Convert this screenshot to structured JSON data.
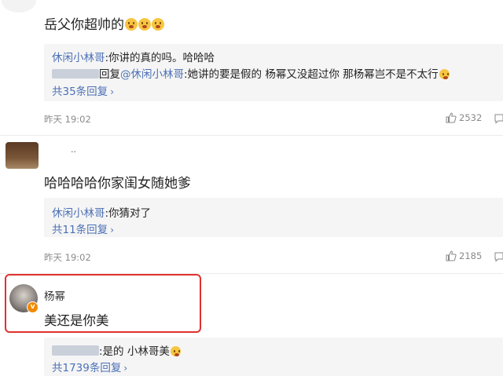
{
  "comment1": {
    "text": "岳父你超帅的",
    "replies": [
      {
        "user": "休闲小林哥",
        "text": ":你讲的真的吗。哈哈哈"
      },
      {
        "prefix": "回复",
        "mention": "@休闲小林哥",
        "text": ":她讲的要是假的 杨幂又没超过你 那杨幂岂不是不太行"
      }
    ],
    "more": "共35条回复",
    "time": "昨天 19:02",
    "likes": "2532"
  },
  "comment2": {
    "name_partial": "..",
    "text": "哈哈哈哈你家闺女随她爹",
    "replies": [
      {
        "user": "休闲小林哥",
        "text": ":你猜对了"
      }
    ],
    "more": "共11条回复",
    "time": "昨天 19:02",
    "likes": "2185"
  },
  "comment3": {
    "user": "杨幂",
    "text": "美还是你美",
    "replies": [
      {
        "text": ":是的 小林哥美"
      }
    ],
    "more": "共1739条回复"
  },
  "colors": {
    "link": "#4c70b5",
    "highlight": "#e0322e",
    "verified": "#f08a00"
  },
  "icons": [
    "thumbs-up-icon",
    "comment-icon",
    "chevron-right-icon",
    "verified-badge-icon",
    "shocked-emoji-icon",
    "laughing-emoji-icon"
  ]
}
